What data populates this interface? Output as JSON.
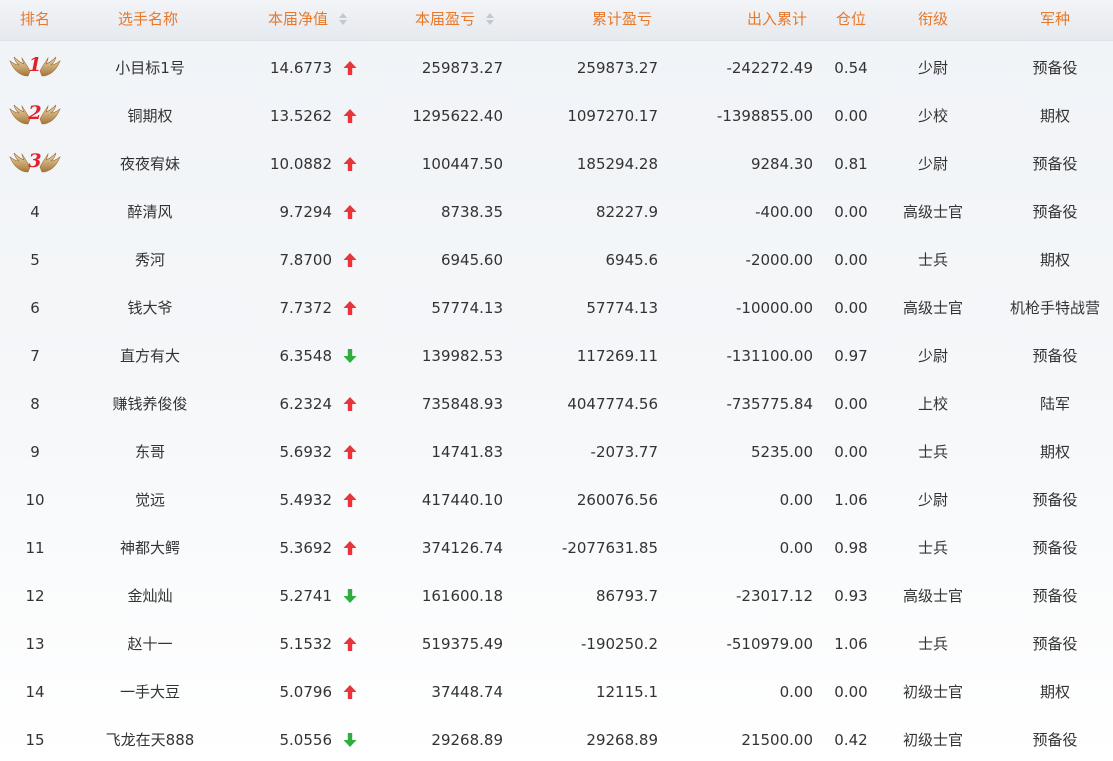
{
  "header": {
    "rank": "排名",
    "name": "选手名称",
    "nav": "本届净值",
    "pnl": "本届盈亏",
    "cum_pnl": "累计盈亏",
    "cash_flow": "出入累计",
    "position": "仓位",
    "title_rank": "衔级",
    "arm": "军种"
  },
  "colors": {
    "header_text": "#e8782a",
    "up": "#e8343a",
    "down": "#2fae3f",
    "medal_number": "#e1222b",
    "wing": "#c9a064"
  },
  "rows": [
    {
      "rank": "1",
      "medal": true,
      "name": "小目标1号",
      "nav": "14.6773",
      "trend": "up",
      "pnl": "259873.27",
      "cum_pnl": "259873.27",
      "cash_flow": "-242272.49",
      "position": "0.54",
      "title_rank": "少尉",
      "arm": "预备役"
    },
    {
      "rank": "2",
      "medal": true,
      "name": "铜期权",
      "nav": "13.5262",
      "trend": "up",
      "pnl": "1295622.40",
      "cum_pnl": "1097270.17",
      "cash_flow": "-1398855.00",
      "position": "0.00",
      "title_rank": "少校",
      "arm": "期权"
    },
    {
      "rank": "3",
      "medal": true,
      "name": "夜夜宥妹",
      "nav": "10.0882",
      "trend": "up",
      "pnl": "100447.50",
      "cum_pnl": "185294.28",
      "cash_flow": "9284.30",
      "position": "0.81",
      "title_rank": "少尉",
      "arm": "预备役"
    },
    {
      "rank": "4",
      "medal": false,
      "name": "醉清风",
      "nav": "9.7294",
      "trend": "up",
      "pnl": "8738.35",
      "cum_pnl": "82227.9",
      "cash_flow": "-400.00",
      "position": "0.00",
      "title_rank": "高级士官",
      "arm": "预备役"
    },
    {
      "rank": "5",
      "medal": false,
      "name": "秀河",
      "nav": "7.8700",
      "trend": "up",
      "pnl": "6945.60",
      "cum_pnl": "6945.6",
      "cash_flow": "-2000.00",
      "position": "0.00",
      "title_rank": "士兵",
      "arm": "期权"
    },
    {
      "rank": "6",
      "medal": false,
      "name": "钱大爷",
      "nav": "7.7372",
      "trend": "up",
      "pnl": "57774.13",
      "cum_pnl": "57774.13",
      "cash_flow": "-10000.00",
      "position": "0.00",
      "title_rank": "高级士官",
      "arm": "机枪手特战营"
    },
    {
      "rank": "7",
      "medal": false,
      "name": "直方有大",
      "nav": "6.3548",
      "trend": "down",
      "pnl": "139982.53",
      "cum_pnl": "117269.11",
      "cash_flow": "-131100.00",
      "position": "0.97",
      "title_rank": "少尉",
      "arm": "预备役"
    },
    {
      "rank": "8",
      "medal": false,
      "name": "赚钱养俊俊",
      "nav": "6.2324",
      "trend": "up",
      "pnl": "735848.93",
      "cum_pnl": "4047774.56",
      "cash_flow": "-735775.84",
      "position": "0.00",
      "title_rank": "上校",
      "arm": "陆军"
    },
    {
      "rank": "9",
      "medal": false,
      "name": "东哥",
      "nav": "5.6932",
      "trend": "up",
      "pnl": "14741.83",
      "cum_pnl": "-2073.77",
      "cash_flow": "5235.00",
      "position": "0.00",
      "title_rank": "士兵",
      "arm": "期权"
    },
    {
      "rank": "10",
      "medal": false,
      "name": "觉远",
      "nav": "5.4932",
      "trend": "up",
      "pnl": "417440.10",
      "cum_pnl": "260076.56",
      "cash_flow": "0.00",
      "position": "1.06",
      "title_rank": "少尉",
      "arm": "预备役"
    },
    {
      "rank": "11",
      "medal": false,
      "name": "神都大鳄",
      "nav": "5.3692",
      "trend": "up",
      "pnl": "374126.74",
      "cum_pnl": "-2077631.85",
      "cash_flow": "0.00",
      "position": "0.98",
      "title_rank": "士兵",
      "arm": "预备役"
    },
    {
      "rank": "12",
      "medal": false,
      "name": "金灿灿",
      "nav": "5.2741",
      "trend": "down",
      "pnl": "161600.18",
      "cum_pnl": "86793.7",
      "cash_flow": "-23017.12",
      "position": "0.93",
      "title_rank": "高级士官",
      "arm": "预备役"
    },
    {
      "rank": "13",
      "medal": false,
      "name": "赵十一",
      "nav": "5.1532",
      "trend": "up",
      "pnl": "519375.49",
      "cum_pnl": "-190250.2",
      "cash_flow": "-510979.00",
      "position": "1.06",
      "title_rank": "士兵",
      "arm": "预备役"
    },
    {
      "rank": "14",
      "medal": false,
      "name": "一手大豆",
      "nav": "5.0796",
      "trend": "up",
      "pnl": "37448.74",
      "cum_pnl": "12115.1",
      "cash_flow": "0.00",
      "position": "0.00",
      "title_rank": "初级士官",
      "arm": "期权"
    },
    {
      "rank": "15",
      "medal": false,
      "name": "飞龙在天888",
      "nav": "5.0556",
      "trend": "down",
      "pnl": "29268.89",
      "cum_pnl": "29268.89",
      "cash_flow": "21500.00",
      "position": "0.42",
      "title_rank": "初级士官",
      "arm": "预备役"
    }
  ]
}
